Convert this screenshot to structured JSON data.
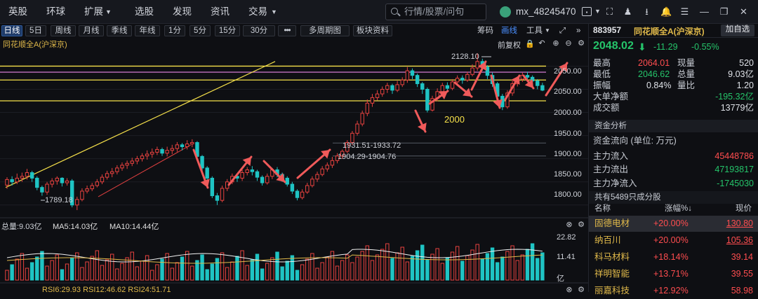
{
  "menu": [
    "英股",
    "环球",
    "扩展",
    "选股",
    "发现",
    "资讯",
    "交易"
  ],
  "search": {
    "placeholder": "行情/股票/问句"
  },
  "user": {
    "name": "mx_48245470"
  },
  "toolbar": {
    "periods": [
      "日线",
      "5日",
      "周线",
      "月线",
      "季线",
      "年线",
      "1分",
      "5分",
      "15分",
      "30分"
    ],
    "more": "•••",
    "multi": "多周期图",
    "plate": "板块资料",
    "right": [
      "筹码",
      "画线",
      "工具"
    ]
  },
  "chart": {
    "restore": "前复权",
    "price_labels": [
      "2050.00",
      "2000.00",
      "1950.00",
      "1900.00",
      "1850.00",
      "1800.00"
    ],
    "annotations": {
      "high": "2128.10",
      "low": "1789.18",
      "range1": "1931.51-1933.72",
      "range2": "1904.29-1904.76",
      "mark2000": "2000"
    },
    "volume": {
      "total_label": "总量:9.03亿",
      "ma5": "MA5:14.03亿",
      "ma10": "MA10:14.44亿",
      "axis_top": "22.82",
      "axis_mid": "11.41",
      "unit": "亿"
    },
    "rsi_label": "RSI6:29.93 RSI12:46.62 RSI24:51.71"
  },
  "stock": {
    "code": "883957",
    "name": "同花顺全A(沪深京)",
    "add_fav": "加自选",
    "price": "2048.02",
    "change": "-11.29",
    "pct": "-0.55%",
    "stats": [
      {
        "l1": "最高",
        "v1": "2064.01",
        "l2": "现量",
        "v2": "520"
      },
      {
        "l1": "最低",
        "v1": "2046.62",
        "l2": "总量",
        "v2": "9.03亿"
      },
      {
        "l1": "振幅",
        "v1": "0.84%",
        "l2": "量比",
        "v2": "1.20"
      }
    ],
    "big_net": {
      "label": "大单净额",
      "value": "-195.32亿"
    },
    "turnover": {
      "label": "成交额",
      "value": "13779亿"
    }
  },
  "capital": {
    "title": "资金分析",
    "unit": "资金流向 (单位: 万元)",
    "rows": [
      {
        "label": "主力流入",
        "value": "45448786"
      },
      {
        "label": "主力流出",
        "value": "47193817"
      },
      {
        "label": "主力净流入",
        "value": "-1745030"
      }
    ],
    "count": "共有5489只成分股"
  },
  "table": {
    "headers": [
      "名称",
      "涨幅%↓",
      "现价"
    ],
    "rows": [
      {
        "name": "固德电材",
        "pct": "+20.00%",
        "price": "130.80"
      },
      {
        "name": "纳百川",
        "pct": "+20.00%",
        "price": "105.36"
      },
      {
        "name": "科马材料",
        "pct": "+18.14%",
        "price": "39.14"
      },
      {
        "name": "祥明智能",
        "pct": "+13.71%",
        "price": "39.55"
      },
      {
        "name": "丽嘉科技",
        "pct": "+12.92%",
        "price": "58.98"
      }
    ]
  },
  "chart_data": {
    "type": "candlestick",
    "title": "同花顺全A(沪深京)",
    "ylim": [
      1780,
      2140
    ],
    "high": 2128.1,
    "low": 1789.18,
    "candles": [
      [
        1843,
        1855,
        1835,
        1860
      ],
      [
        1855,
        1850,
        1842,
        1862
      ],
      [
        1850,
        1858,
        1845,
        1868
      ],
      [
        1858,
        1862,
        1850,
        1870
      ],
      [
        1862,
        1870,
        1855,
        1878
      ],
      [
        1870,
        1858,
        1850,
        1874
      ],
      [
        1858,
        1838,
        1832,
        1862
      ],
      [
        1838,
        1828,
        1820,
        1842
      ],
      [
        1828,
        1845,
        1822,
        1850
      ],
      [
        1845,
        1852,
        1838,
        1858
      ],
      [
        1852,
        1858,
        1844,
        1862
      ],
      [
        1858,
        1848,
        1840,
        1860
      ],
      [
        1848,
        1852,
        1842,
        1858
      ],
      [
        1852,
        1800,
        1795,
        1856
      ],
      [
        1800,
        1812,
        1789,
        1818
      ],
      [
        1812,
        1830,
        1808,
        1836
      ],
      [
        1830,
        1835,
        1825,
        1842
      ],
      [
        1835,
        1842,
        1830,
        1848
      ],
      [
        1842,
        1850,
        1838,
        1856
      ],
      [
        1850,
        1860,
        1845,
        1866
      ],
      [
        1860,
        1868,
        1855,
        1874
      ],
      [
        1868,
        1872,
        1860,
        1880
      ],
      [
        1872,
        1880,
        1866,
        1886
      ],
      [
        1880,
        1886,
        1874,
        1892
      ],
      [
        1886,
        1890,
        1878,
        1896
      ],
      [
        1890,
        1895,
        1884,
        1902
      ],
      [
        1895,
        1900,
        1888,
        1906
      ],
      [
        1900,
        1906,
        1894,
        1912
      ],
      [
        1906,
        1910,
        1898,
        1918
      ],
      [
        1910,
        1914,
        1902,
        1922
      ],
      [
        1914,
        1920,
        1908,
        1926
      ],
      [
        1920,
        1912,
        1906,
        1924
      ],
      [
        1912,
        1918,
        1905,
        1926
      ],
      [
        1918,
        1922,
        1910,
        1930
      ],
      [
        1922,
        1930,
        1915,
        1936
      ],
      [
        1930,
        1926,
        1918,
        1934
      ],
      [
        1926,
        1932,
        1920,
        1940
      ],
      [
        1932,
        1935,
        1925,
        1942
      ],
      [
        1935,
        1905,
        1898,
        1938
      ],
      [
        1905,
        1880,
        1872,
        1908
      ],
      [
        1880,
        1858,
        1850,
        1884
      ],
      [
        1858,
        1820,
        1815,
        1862
      ],
      [
        1820,
        1810,
        1800,
        1826
      ],
      [
        1810,
        1836,
        1806,
        1842
      ],
      [
        1836,
        1850,
        1830,
        1856
      ],
      [
        1850,
        1862,
        1845,
        1868
      ],
      [
        1862,
        1858,
        1850,
        1866
      ],
      [
        1858,
        1870,
        1852,
        1876
      ],
      [
        1870,
        1876,
        1864,
        1882
      ],
      [
        1876,
        1872,
        1864,
        1884
      ],
      [
        1872,
        1860,
        1852,
        1876
      ],
      [
        1860,
        1848,
        1842,
        1864
      ],
      [
        1848,
        1862,
        1844,
        1868
      ],
      [
        1862,
        1876,
        1856,
        1880
      ],
      [
        1876,
        1866,
        1860,
        1882
      ],
      [
        1866,
        1858,
        1850,
        1870
      ],
      [
        1858,
        1845,
        1840,
        1862
      ],
      [
        1845,
        1830,
        1824,
        1850
      ],
      [
        1830,
        1816,
        1810,
        1834
      ],
      [
        1816,
        1828,
        1812,
        1834
      ],
      [
        1828,
        1842,
        1824,
        1848
      ],
      [
        1842,
        1856,
        1838,
        1862
      ],
      [
        1856,
        1866,
        1850,
        1872
      ],
      [
        1866,
        1878,
        1862,
        1884
      ],
      [
        1878,
        1886,
        1872,
        1892
      ],
      [
        1886,
        1896,
        1880,
        1904
      ],
      [
        1896,
        1906,
        1890,
        1912
      ],
      [
        1906,
        1916,
        1900,
        1920
      ],
      [
        1916,
        1935,
        1912,
        1940
      ],
      [
        1935,
        1955,
        1930,
        1960
      ],
      [
        1955,
        1975,
        1950,
        1982
      ],
      [
        1975,
        1998,
        1970,
        2004
      ],
      [
        1998,
        2020,
        1992,
        2028
      ],
      [
        2020,
        2032,
        2012,
        2040
      ],
      [
        2032,
        2040,
        2026,
        2048
      ],
      [
        2040,
        2050,
        2034,
        2056
      ],
      [
        2050,
        2058,
        2042,
        2064
      ],
      [
        2058,
        2048,
        2040,
        2062
      ],
      [
        2048,
        2060,
        2044,
        2068
      ],
      [
        2060,
        2070,
        2055,
        2076
      ],
      [
        2070,
        2090,
        2064,
        2098
      ],
      [
        2090,
        2080,
        2072,
        2095
      ],
      [
        2080,
        2062,
        2055,
        2084
      ],
      [
        2062,
        2050,
        2040,
        2066
      ],
      [
        2050,
        2005,
        2000,
        2054
      ],
      [
        2005,
        2030,
        2002,
        2036
      ],
      [
        2030,
        2045,
        2024,
        2052
      ],
      [
        2045,
        2058,
        2040,
        2064
      ],
      [
        2058,
        2052,
        2046,
        2065
      ],
      [
        2052,
        2066,
        2048,
        2072
      ],
      [
        2066,
        2074,
        2060,
        2080
      ],
      [
        2074,
        2070,
        2062,
        2080
      ],
      [
        2070,
        2082,
        2066,
        2088
      ],
      [
        2082,
        2096,
        2078,
        2104
      ],
      [
        2096,
        2110,
        2090,
        2128
      ],
      [
        2110,
        2098,
        2090,
        2116
      ],
      [
        2098,
        2080,
        2072,
        2102
      ],
      [
        2080,
        2062,
        2055,
        2086
      ],
      [
        2062,
        2035,
        2028,
        2066
      ],
      [
        2035,
        2012,
        2005,
        2040
      ],
      [
        2012,
        2042,
        2008,
        2048
      ],
      [
        2042,
        2062,
        2036,
        2068
      ],
      [
        2062,
        2072,
        2056,
        2078
      ],
      [
        2072,
        2080,
        2066,
        2086
      ],
      [
        2080,
        2076,
        2068,
        2088
      ],
      [
        2076,
        2068,
        2060,
        2080
      ],
      [
        2068,
        2058,
        2050,
        2072
      ],
      [
        2058,
        2048,
        2046,
        2064
      ]
    ],
    "hlines": [
      2100,
      2087,
      2070,
      2025
    ]
  }
}
